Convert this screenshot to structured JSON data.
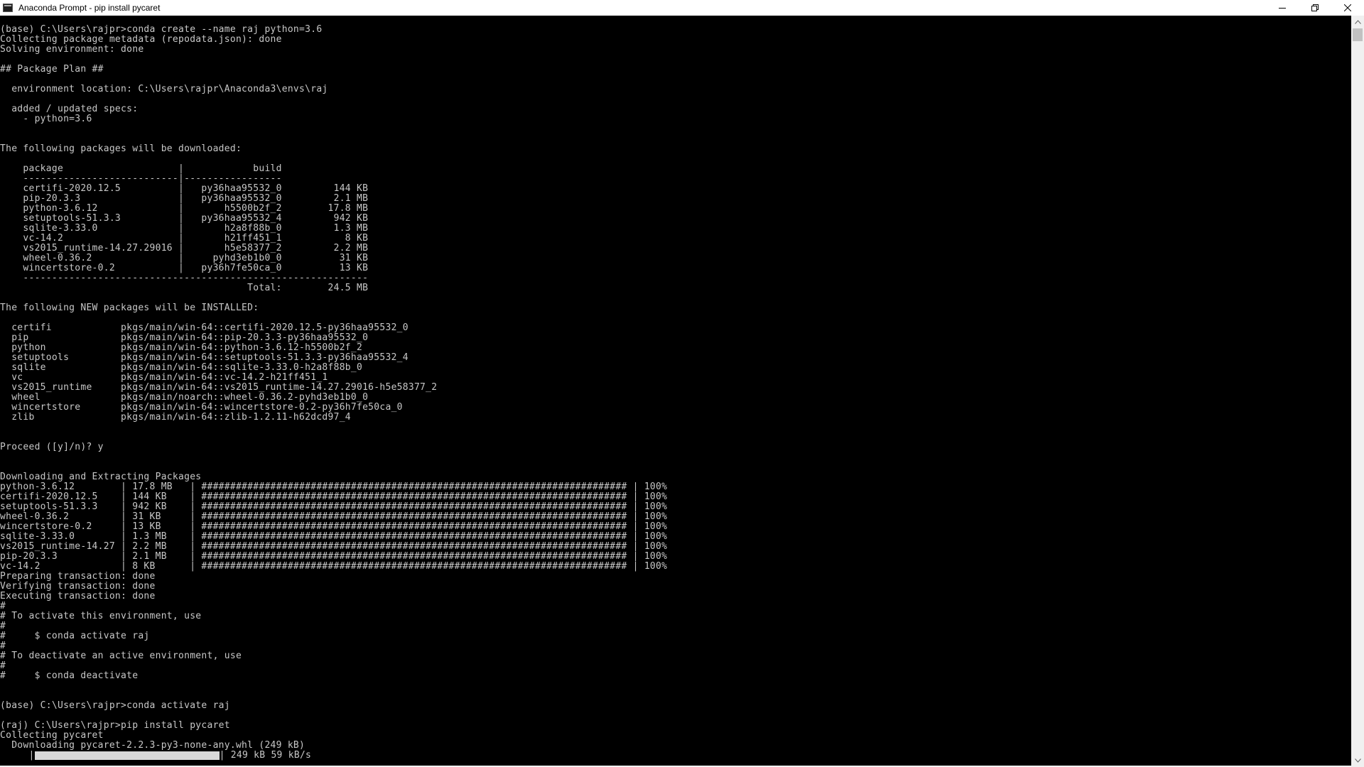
{
  "window": {
    "title": "Anaconda Prompt - pip  install pycaret",
    "controls": {
      "minimize": "minimize-icon",
      "restore": "restore-icon",
      "close": "close-icon"
    }
  },
  "terminal": {
    "foreground": "#c8c8c8",
    "background": "#000000",
    "lines": [
      "(base) C:\\Users\\rajpr>conda create --name raj python=3.6",
      "Collecting package metadata (repodata.json): done",
      "Solving environment: done",
      "",
      "## Package Plan ##",
      "",
      "  environment location: C:\\Users\\rajpr\\Anaconda3\\envs\\raj",
      "",
      "  added / updated specs:",
      "    - python=3.6",
      "",
      "",
      "The following packages will be downloaded:",
      "",
      "    package                    |            build",
      "    ---------------------------|-----------------",
      "    certifi-2020.12.5          |   py36haa95532_0         144 KB",
      "    pip-20.3.3                 |   py36haa95532_0         2.1 MB",
      "    python-3.6.12              |       h5500b2f_2        17.8 MB",
      "    setuptools-51.3.3          |   py36haa95532_4         942 KB",
      "    sqlite-3.33.0              |       h2a8f88b_0         1.3 MB",
      "    vc-14.2                    |       h21ff451_1           8 KB",
      "    vs2015_runtime-14.27.29016 |       h5e58377_2         2.2 MB",
      "    wheel-0.36.2               |     pyhd3eb1b0_0          31 KB",
      "    wincertstore-0.2           |   py36h7fe50ca_0          13 KB",
      "    ------------------------------------------------------------",
      "                                           Total:        24.5 MB",
      "",
      "The following NEW packages will be INSTALLED:",
      "",
      "  certifi            pkgs/main/win-64::certifi-2020.12.5-py36haa95532_0",
      "  pip                pkgs/main/win-64::pip-20.3.3-py36haa95532_0",
      "  python             pkgs/main/win-64::python-3.6.12-h5500b2f_2",
      "  setuptools         pkgs/main/win-64::setuptools-51.3.3-py36haa95532_4",
      "  sqlite             pkgs/main/win-64::sqlite-3.33.0-h2a8f88b_0",
      "  vc                 pkgs/main/win-64::vc-14.2-h21ff451_1",
      "  vs2015_runtime     pkgs/main/win-64::vs2015_runtime-14.27.29016-h5e58377_2",
      "  wheel              pkgs/main/noarch::wheel-0.36.2-pyhd3eb1b0_0",
      "  wincertstore       pkgs/main/win-64::wincertstore-0.2-py36h7fe50ca_0",
      "  zlib               pkgs/main/win-64::zlib-1.2.11-h62dcd97_4",
      "",
      "",
      "Proceed ([y]/n)? y",
      "",
      "",
      "Downloading and Extracting Packages",
      "python-3.6.12        | 17.8 MB   | ########################################################################## | 100%",
      "certifi-2020.12.5    | 144 KB    | ########################################################################## | 100%",
      "setuptools-51.3.3    | 942 KB    | ########################################################################## | 100%",
      "wheel-0.36.2         | 31 KB     | ########################################################################## | 100%",
      "wincertstore-0.2     | 13 KB     | ########################################################################## | 100%",
      "sqlite-3.33.0        | 1.3 MB    | ########################################################################## | 100%",
      "vs2015_runtime-14.27 | 2.2 MB    | ########################################################################## | 100%",
      "pip-20.3.3           | 2.1 MB    | ########################################################################## | 100%",
      "vc-14.2              | 8 KB      | ########################################################################## | 100%",
      "Preparing transaction: done",
      "Verifying transaction: done",
      "Executing transaction: done",
      "#",
      "# To activate this environment, use",
      "#",
      "#     $ conda activate raj",
      "#",
      "# To deactivate an active environment, use",
      "#",
      "#     $ conda deactivate",
      "",
      "",
      "(base) C:\\Users\\rajpr>conda activate raj",
      "",
      "(raj) C:\\Users\\rajpr>pip install pycaret",
      "Collecting pycaret",
      "  Downloading pycaret-2.2.3-py3-none-any.whl (249 kB)"
    ],
    "progress": {
      "prefix": "     |",
      "suffix": "| 249 kB 59 kB/s",
      "fraction": 1.0
    }
  }
}
